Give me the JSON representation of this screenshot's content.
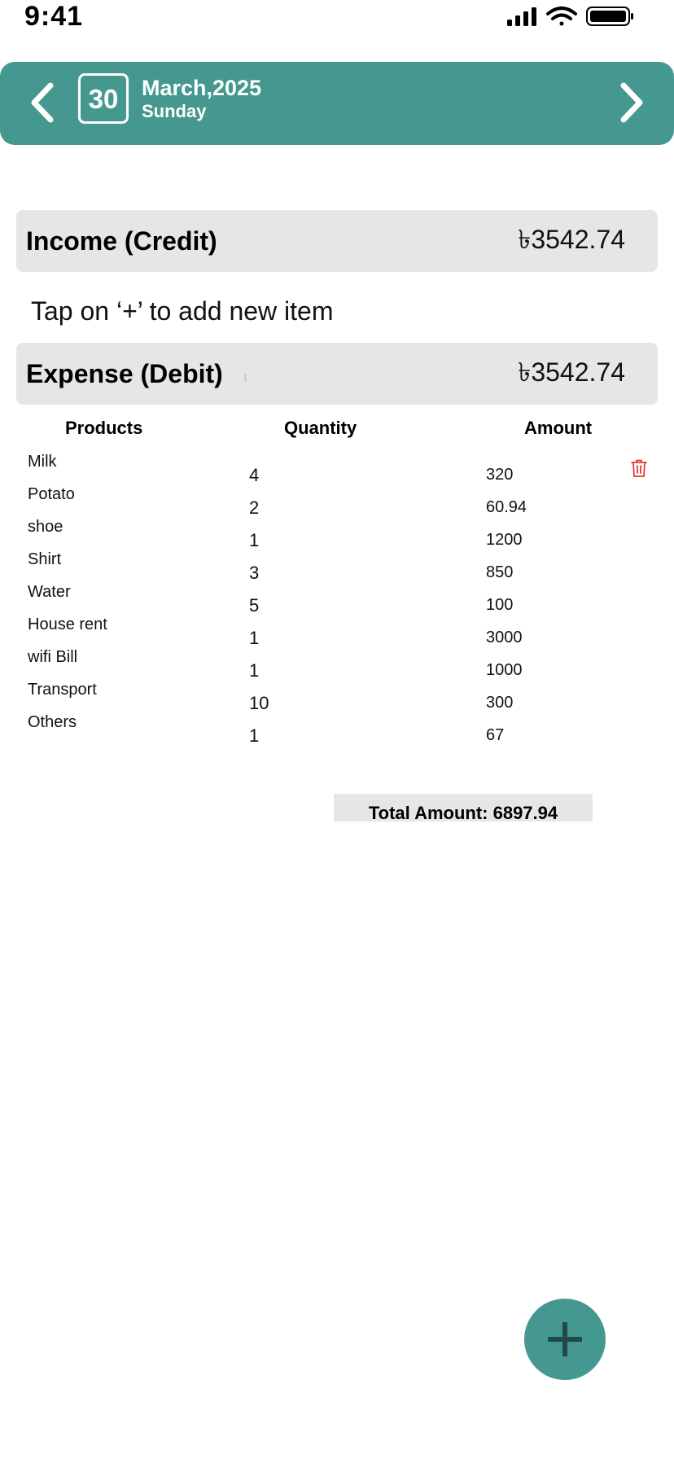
{
  "status_bar": {
    "time": "9:41"
  },
  "header": {
    "day": "30",
    "month_year": "March,2025",
    "weekday": "Sunday",
    "accent_color": "#44988f"
  },
  "income": {
    "label": "Income (Credit)",
    "value": "৳3542.74"
  },
  "hint": "Tap on ‘+’ to add new item",
  "expense": {
    "label": "Expense (Debit)",
    "value": "৳3542.74"
  },
  "table": {
    "headers": {
      "products": "Products",
      "quantity": "Quantity",
      "amount": "Amount"
    },
    "rows": [
      {
        "product": "Milk",
        "quantity": "4",
        "amount": "320"
      },
      {
        "product": "Potato",
        "quantity": "2",
        "amount": "60.94"
      },
      {
        "product": "shoe",
        "quantity": "1",
        "amount": "1200"
      },
      {
        "product": "Shirt",
        "quantity": "3",
        "amount": "850"
      },
      {
        "product": "Water",
        "quantity": "5",
        "amount": "100"
      },
      {
        "product": "House rent",
        "quantity": "1",
        "amount": "3000"
      },
      {
        "product": "wifi Bill",
        "quantity": "1",
        "amount": "1000"
      },
      {
        "product": "Transport",
        "quantity": "10",
        "amount": "300"
      },
      {
        "product": "Others",
        "quantity": "1",
        "amount": "67"
      }
    ]
  },
  "total": {
    "label": "Total Amount: 6897.94"
  },
  "icons": {
    "back": "chevron-left-icon",
    "forward": "chevron-right-icon",
    "delete": "trash-icon",
    "add": "plus-icon",
    "delete_color": "#e53935"
  }
}
